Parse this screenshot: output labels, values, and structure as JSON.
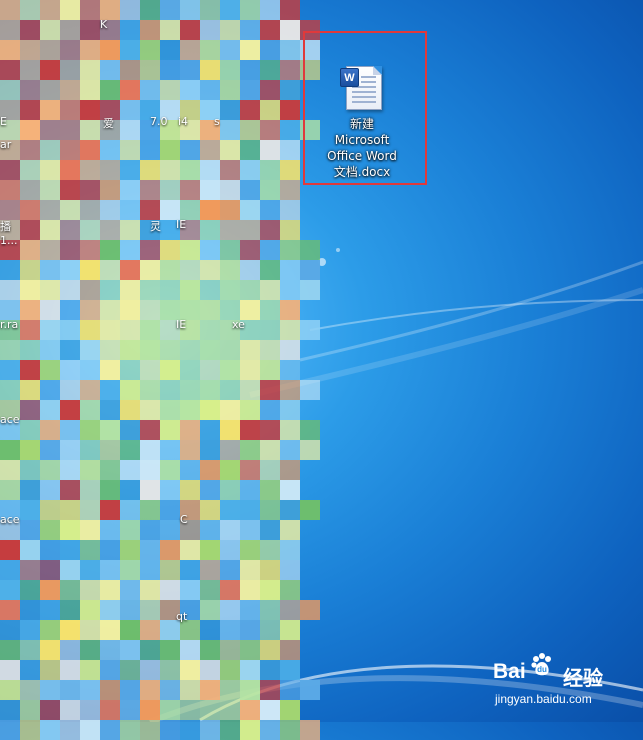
{
  "desktop": {
    "selected_icon": {
      "name_lines": [
        "新建",
        "Microsoft",
        "Office Word",
        "文档.docx"
      ],
      "badge_letter": "W",
      "icon": "word-document-icon"
    },
    "highlight_color": "#e0393b",
    "partial_labels": [
      {
        "text": "K",
        "kind": "blurred-icon-label"
      },
      {
        "text": "爱",
        "kind": "blurred-icon-label"
      },
      {
        "text": "7.0",
        "kind": "blurred-icon-label"
      },
      {
        "text": "i4",
        "kind": "blurred-icon-label"
      },
      {
        "text": "s",
        "kind": "blurred-icon-label"
      },
      {
        "text": "E",
        "kind": "blurred-icon-label"
      },
      {
        "text": "ar",
        "kind": "blurred-icon-label"
      },
      {
        "text": "播",
        "kind": "blurred-icon-label"
      },
      {
        "text": "1...",
        "kind": "blurred-icon-label"
      },
      {
        "text": "灵",
        "kind": "blurred-icon-label"
      },
      {
        "text": "IE",
        "kind": "blurred-icon-label"
      },
      {
        "text": "r.ra",
        "kind": "blurred-icon-label"
      },
      {
        "text": "IE",
        "kind": "blurred-icon-label"
      },
      {
        "text": "xe",
        "kind": "blurred-icon-label"
      },
      {
        "text": "ace",
        "kind": "blurred-icon-label"
      },
      {
        "text": "ace",
        "kind": "blurred-icon-label"
      },
      {
        "text": "C",
        "kind": "blurred-icon-label"
      },
      {
        "text": "qt",
        "kind": "blurred-icon-label"
      }
    ]
  },
  "watermark": {
    "brand": "Bai",
    "brand_suffix": "经验",
    "url": "jingyan.baidu.com",
    "icon": "baidu-paw-icon"
  }
}
